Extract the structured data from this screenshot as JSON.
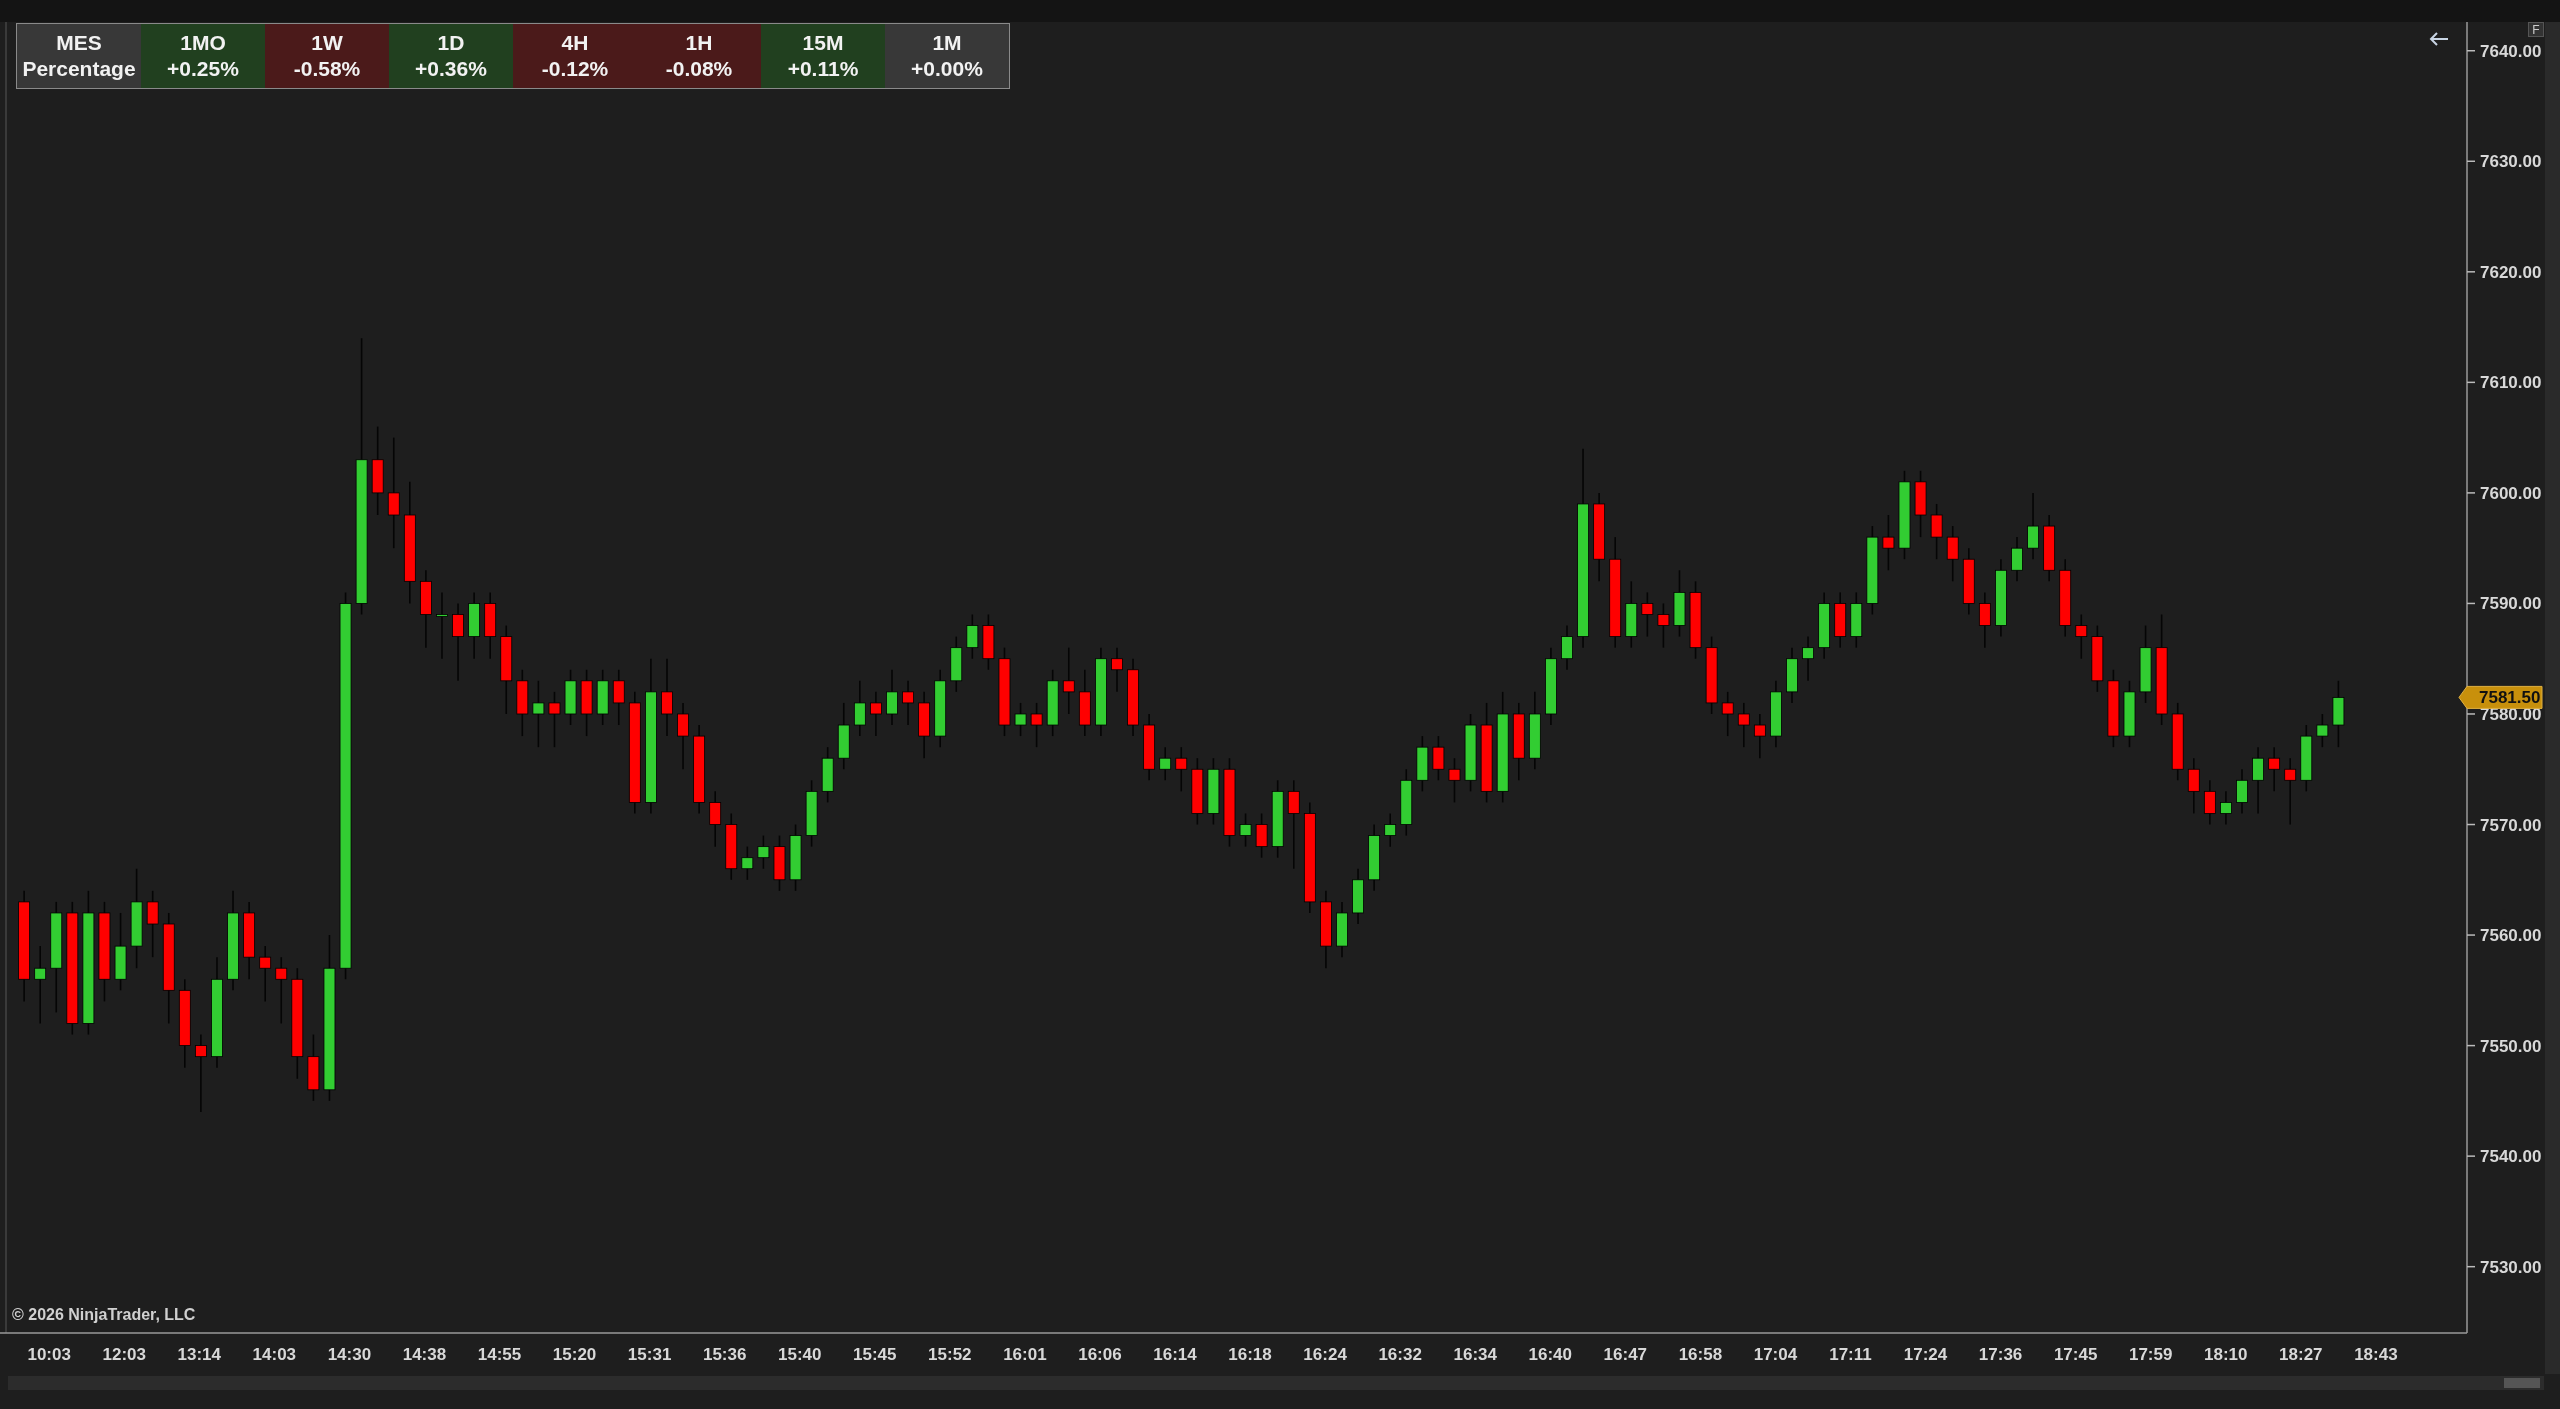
{
  "top_bar": {
    "button": "F"
  },
  "header_table": {
    "columns": [
      {
        "label": "MES",
        "value": "Percentage",
        "color": "#383838"
      },
      {
        "label": "1MO",
        "value": "+0.25%",
        "color": "#21401f"
      },
      {
        "label": "1W",
        "value": "-0.58%",
        "color": "#4b1a1a"
      },
      {
        "label": "1D",
        "value": "+0.36%",
        "color": "#21401f"
      },
      {
        "label": "4H",
        "value": "-0.12%",
        "color": "#4b1a1a"
      },
      {
        "label": "1H",
        "value": "-0.08%",
        "color": "#4b1a1a"
      },
      {
        "label": "15M",
        "value": "+0.11%",
        "color": "#21401f"
      },
      {
        "label": "1M",
        "value": "+0.00%",
        "color": "#383838"
      }
    ]
  },
  "chart": {
    "copyright": "© 2026 NinjaTrader, LLC",
    "price_labels": [
      "7640.00",
      "7630.00",
      "7620.00",
      "7610.00",
      "7600.00",
      "7590.00",
      "7580.00",
      "7570.00",
      "7560.00",
      "7550.00",
      "7540.00",
      "7530.00"
    ],
    "time_labels": [
      "10:03",
      "12:03",
      "13:14",
      "14:03",
      "14:30",
      "14:38",
      "14:55",
      "15:20",
      "15:31",
      "15:36",
      "15:40",
      "15:45",
      "15:52",
      "16:01",
      "16:06",
      "16:14",
      "16:18",
      "16:24",
      "16:32",
      "16:34",
      "16:40",
      "16:47",
      "16:58",
      "17:04",
      "17:11",
      "17:24",
      "17:36",
      "17:45",
      "17:59",
      "18:10",
      "18:27",
      "18:43"
    ],
    "last_price": "7581.50"
  }
}
